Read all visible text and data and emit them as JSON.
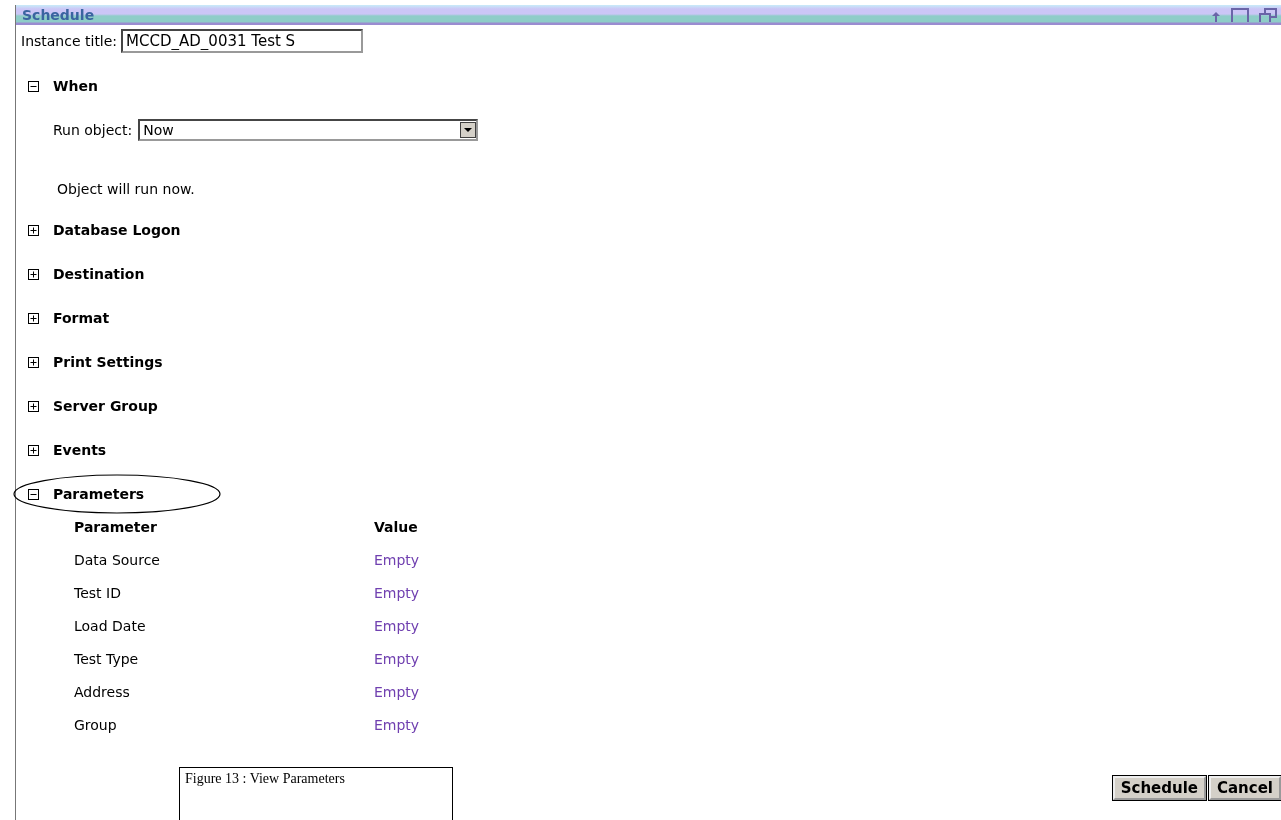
{
  "panel": {
    "title": "Schedule"
  },
  "instance_title": {
    "label": "Instance title:",
    "value": "MCCD_AD_0031 Test S"
  },
  "sections": [
    {
      "label": "When",
      "expanded": true,
      "kind": "when",
      "run_object": {
        "label": "Run object:",
        "value": "Now"
      },
      "note": "Object will run now."
    },
    {
      "label": "Database Logon",
      "expanded": false
    },
    {
      "label": "Destination",
      "expanded": false
    },
    {
      "label": "Format",
      "expanded": false
    },
    {
      "label": "Print Settings",
      "expanded": false
    },
    {
      "label": "Server Group",
      "expanded": false
    },
    {
      "label": "Events",
      "expanded": false
    },
    {
      "label": "Parameters",
      "expanded": true,
      "circled": true,
      "kind": "parameters",
      "columns": [
        "Parameter",
        "Value"
      ],
      "rows": [
        {
          "name": "Data Source",
          "value": "Empty"
        },
        {
          "name": "Test ID",
          "value": "Empty"
        },
        {
          "name": "Load Date",
          "value": "Empty"
        },
        {
          "name": "Test Type",
          "value": "Empty"
        },
        {
          "name": "Address",
          "value": "Empty"
        },
        {
          "name": "Group",
          "value": "Empty"
        }
      ]
    }
  ],
  "caption": "Figure 13 : View Parameters",
  "buttons": [
    "Schedule",
    "Cancel"
  ]
}
